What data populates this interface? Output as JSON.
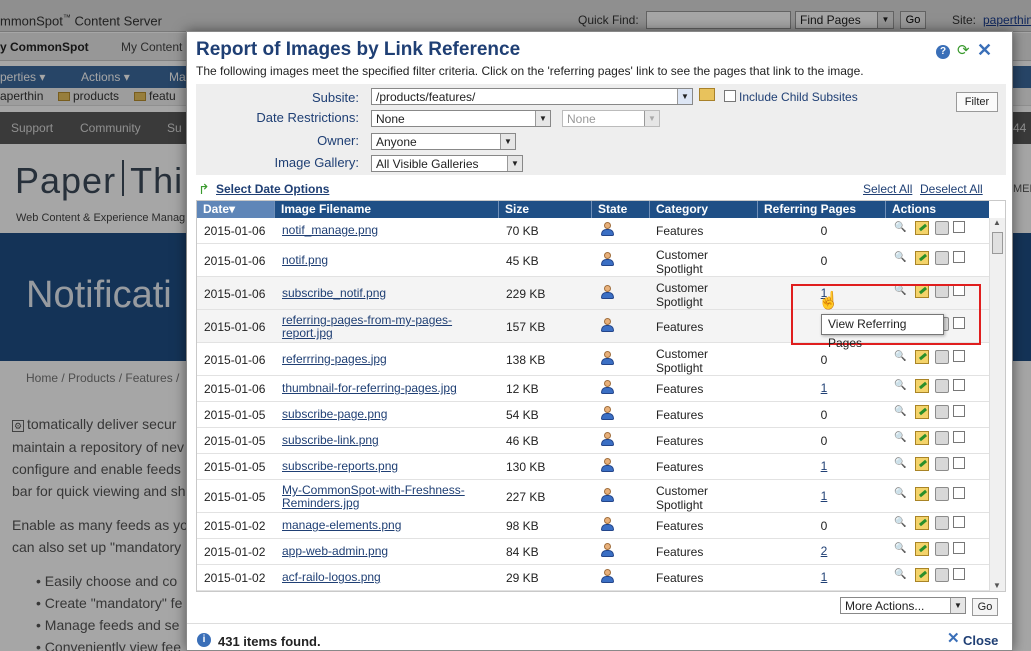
{
  "bg_app": {
    "brand": "mmonSpot",
    "brand_tm": "™",
    "brand_suffix": "Content Server",
    "quick_find_label": "Quick Find:",
    "quick_find_select": "Find Pages",
    "quick_find_go": "Go",
    "site_label": "Site:",
    "site_link": "paperthin",
    "tab_my_commonspot": "y CommonSpot",
    "tab_my_content": "My Content",
    "menu_properties": "perties",
    "menu_actions": "Actions",
    "menu_ma": "Ma",
    "crumb_paperthin": "aperthin",
    "crumb_products": "products",
    "crumb_feat": "featu",
    "nav_support": "Support",
    "nav_community": "Community",
    "nav_su": "Su",
    "nav_44": "44",
    "logo_left": "Paper",
    "logo_right": "Thi",
    "tagline": "Web Content & Experience Manag",
    "hero_title": "Notificati",
    "bg_crumbs": "Home / Products / Features /",
    "para1_line1": "tomatically deliver secur",
    "para1_line2": "maintain a repository of nev",
    "para1_line3": "configure and enable feeds",
    "para1_line4": "bar for quick viewing and sh",
    "para2_line1": "Enable as many feeds as yo",
    "para2_line2": "can also set up \"mandatory",
    "bullet1": "Easily choose and co",
    "bullet2": "Create \"mandatory\" fe",
    "bullet3": "Manage feeds and se",
    "bullet4": "Conveniently view fee",
    "right_label": "MER"
  },
  "dialog": {
    "title": "Report of Images by Link Reference",
    "subtitle": "The following images meet the specified filter criteria. Click on the 'referring pages' link to see the pages that link to the image.",
    "help_icon": "?",
    "refresh_icon": "⟳",
    "close_icon": "✕",
    "filters": {
      "subsite_label": "Subsite:",
      "subsite_value": "/products/features/",
      "include_child": "Include Child Subsites",
      "date_label": "Date Restrictions:",
      "date_value": "None",
      "date_value2": "None",
      "owner_label": "Owner:",
      "owner_value": "Anyone",
      "gallery_label": "Image Gallery:",
      "gallery_value": "All Visible Galleries",
      "filter_button": "Filter"
    },
    "select_date_options": "Select Date Options",
    "select_all": "Select All",
    "deselect_all": "Deselect All",
    "columns": [
      "Date▾",
      "Image Filename",
      "Size",
      "State",
      "Category",
      "Referring Pages",
      "Actions"
    ],
    "rows": [
      {
        "date": "2015-01-06",
        "file": "notif_manage.png",
        "size": "70 KB",
        "category": "Features",
        "refs": "0",
        "ref_link": false
      },
      {
        "date": "2015-01-06",
        "file": "notif.png",
        "size": "45 KB",
        "category": "Customer Spotlight",
        "refs": "0",
        "ref_link": false
      },
      {
        "date": "2015-01-06",
        "file": "subscribe_notif.png",
        "size": "229 KB",
        "category": "Customer Spotlight",
        "refs": "1",
        "ref_link": true
      },
      {
        "date": "2015-01-06",
        "file": "referring-pages-from-my-pages-report.jpg",
        "size": "157 KB",
        "category": "Features",
        "refs": "",
        "ref_link": false
      },
      {
        "date": "2015-01-06",
        "file": "referrring-pages.jpg",
        "size": "138 KB",
        "category": "Customer Spotlight",
        "refs": "0",
        "ref_link": false
      },
      {
        "date": "2015-01-06",
        "file": "thumbnail-for-referring-pages.jpg",
        "size": "12 KB",
        "category": "Features",
        "refs": "1",
        "ref_link": true
      },
      {
        "date": "2015-01-05",
        "file": "subscribe-page.png",
        "size": "54 KB",
        "category": "Features",
        "refs": "0",
        "ref_link": false
      },
      {
        "date": "2015-01-05",
        "file": "subscribe-link.png",
        "size": "46 KB",
        "category": "Features",
        "refs": "0",
        "ref_link": false
      },
      {
        "date": "2015-01-05",
        "file": "subscribe-reports.png",
        "size": "130 KB",
        "category": "Features",
        "refs": "1",
        "ref_link": true
      },
      {
        "date": "2015-01-05",
        "file": "My-CommonSpot-with-Freshness-Reminders.jpg",
        "size": "227 KB",
        "category": "Customer Spotlight",
        "refs": "1",
        "ref_link": true
      },
      {
        "date": "2015-01-02",
        "file": "manage-elements.png",
        "size": "98 KB",
        "category": "Features",
        "refs": "0",
        "ref_link": false
      },
      {
        "date": "2015-01-02",
        "file": "app-web-admin.png",
        "size": "84 KB",
        "category": "Features",
        "refs": "2",
        "ref_link": true
      },
      {
        "date": "2015-01-02",
        "file": "acf-railo-logos.png",
        "size": "29 KB",
        "category": "Features",
        "refs": "1",
        "ref_link": true
      }
    ],
    "more_actions": "More Actions...",
    "go": "Go",
    "items_found": "431 items found.",
    "close_label": "Close",
    "tooltip": "View Referring Pages"
  }
}
